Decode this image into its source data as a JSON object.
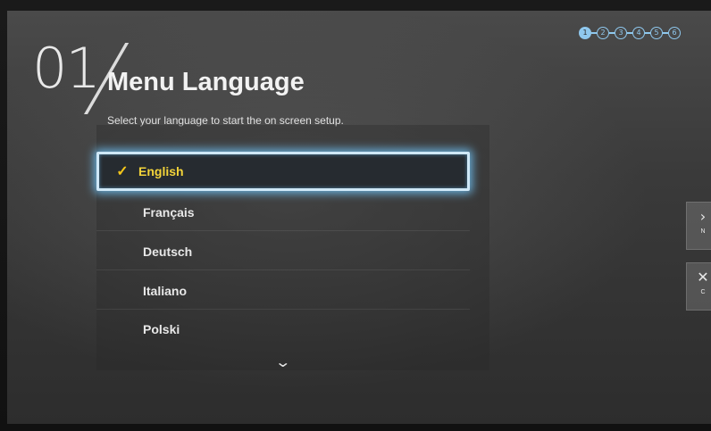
{
  "setup": {
    "step_number": "01",
    "title": "Menu Language",
    "subtitle": "Select your language to start the on screen setup."
  },
  "progress": {
    "steps": [
      "1",
      "2",
      "3",
      "4",
      "5",
      "6"
    ],
    "current_step": 1
  },
  "languages": [
    {
      "label": "English",
      "selected": true,
      "check": "✓"
    },
    {
      "label": "Français",
      "selected": false
    },
    {
      "label": "Deutsch",
      "selected": false
    },
    {
      "label": "Italiano",
      "selected": false
    },
    {
      "label": "Polski",
      "selected": false
    }
  ],
  "side_buttons": {
    "next_label": "N",
    "cancel_label": "C"
  },
  "icons": {
    "more": "chevron-down-icon",
    "next": "arrow-right-icon",
    "cancel": "close-icon"
  },
  "colors": {
    "selection_glow": "#6ebef0",
    "check": "#f3c61a",
    "selected_text": "#f3d43a",
    "progress": "#8fc8ee"
  }
}
